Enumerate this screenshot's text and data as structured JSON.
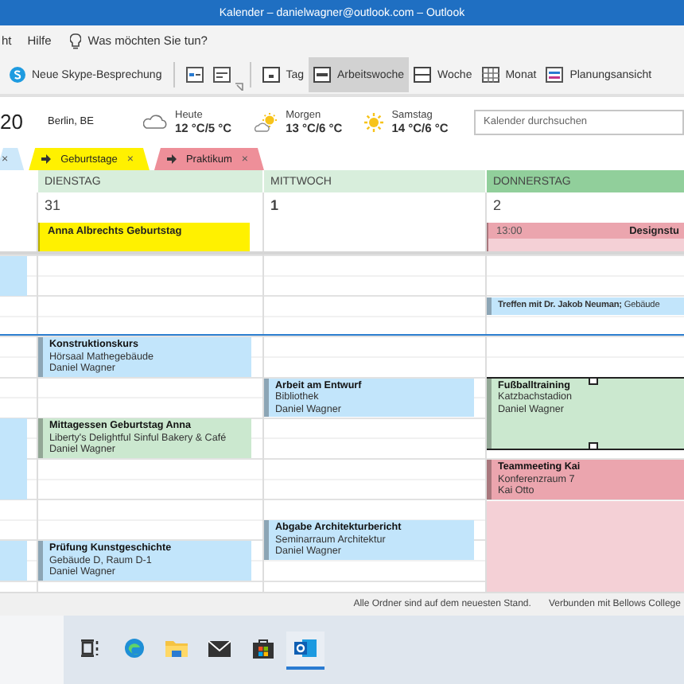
{
  "window": {
    "title": "Kalender – danielwagner@outlook.com – Outlook"
  },
  "menu": {
    "items": [
      "ht",
      "Hilfe"
    ],
    "tell_me": "Was möchten Sie tun?"
  },
  "ribbon": {
    "skype": "Neue Skype-Besprechung",
    "views": [
      {
        "label": "Tag",
        "kind": "day",
        "selected": false
      },
      {
        "label": "Arbeitswoche",
        "kind": "workweek",
        "selected": true
      },
      {
        "label": "Woche",
        "kind": "week",
        "selected": false
      },
      {
        "label": "Monat",
        "kind": "month",
        "selected": false
      },
      {
        "label": "Planungsansicht",
        "kind": "schedule",
        "selected": false
      }
    ]
  },
  "weather": {
    "date": "20",
    "location": "Berlin, BE",
    "forecast": [
      {
        "day": "Heute",
        "temp": "12 °C/5 °C",
        "kind": "cloudy"
      },
      {
        "day": "Morgen",
        "temp": "13 °C/6 °C",
        "kind": "partly-sunny"
      },
      {
        "day": "Samstag",
        "temp": "14 °C/6 °C",
        "kind": "sunny"
      }
    ],
    "search": {
      "placeholder": "Kalender durchsuchen"
    }
  },
  "calendar_tabs": [
    {
      "close": "×",
      "color": "#cde8fa"
    },
    {
      "label": "Geburtstage",
      "close": "×",
      "color": "#fff100"
    },
    {
      "label": "Praktikum",
      "close": "×",
      "color": "#ee8f99"
    }
  ],
  "columns": [
    {
      "events": [
        {
          "kind": "block",
          "color": "#c2e5fb"
        },
        {
          "kind": "block",
          "color": "#c2e5fb"
        },
        {
          "kind": "block",
          "color": "#c2e5fb"
        }
      ]
    },
    {
      "day": "DIENSTAG",
      "date": "31",
      "today": false,
      "current": false,
      "all_day": [
        {
          "title": "Anna Albrechts Geburtstag",
          "color": "#fff100"
        }
      ],
      "events": [
        {
          "kind": "appointment",
          "title": "Konstruktionskurs",
          "location": "Hörsaal Mathegebäude",
          "organizer": "Daniel Wagner",
          "color": "#c2e5fb",
          "selected": false
        },
        {
          "kind": "appointment",
          "title": "Mittagessen Geburtstag Anna",
          "location": "Liberty's Delightful Sinful Bakery & Café",
          "organizer": "Daniel Wagner",
          "color": "#cbe8cf",
          "selected": false
        },
        {
          "kind": "appointment",
          "title": "Prüfung Kunstgeschichte",
          "location": "Gebäude D, Raum D-1",
          "organizer": "Daniel Wagner",
          "color": "#c2e5fb",
          "selected": false
        }
      ]
    },
    {
      "day": "MITTWOCH",
      "date": "1",
      "today": false,
      "current": true,
      "events": [
        {
          "kind": "appointment",
          "title": "Arbeit am Entwurf",
          "location": "Bibliothek",
          "organizer": "Daniel Wagner",
          "color": "#c2e5fb",
          "selected": false
        },
        {
          "kind": "appointment",
          "title": "Abgabe Architekturbericht",
          "location": "Seminarraum Architektur",
          "organizer": "Daniel Wagner",
          "color": "#c2e5fb",
          "selected": false
        }
      ]
    },
    {
      "day": "DONNERSTAG",
      "date": "2",
      "today": true,
      "current": false,
      "all_day": [
        {
          "time": "13:00",
          "title": "Designstu",
          "color": "#eba5ae"
        }
      ],
      "events": [
        {
          "kind": "block",
          "color": "#f4d0d6"
        },
        {
          "kind": "appointment",
          "title": "Treffen mit Dr. Jakob Neuman;",
          "location": "Gebäude",
          "color": "#c2e5fb",
          "selected": false
        },
        {
          "kind": "appointment",
          "title": "Fußballtraining",
          "location": "Katzbachstadion",
          "organizer": "Daniel Wagner",
          "color": "#cbe8cf",
          "selected": true
        },
        {
          "kind": "appointment",
          "title": "Teammeeting Kai",
          "location": "Konferenzraum 7",
          "organizer": "Kai Otto",
          "color": "#eba5ae",
          "selected": false
        }
      ]
    }
  ],
  "status_bar": [
    "Alle Ordner sind auf dem neuesten Stand.",
    "Verbunden mit Bellows College"
  ],
  "taskbar": [
    {
      "kind": "taskview",
      "active": false
    },
    {
      "kind": "browser",
      "active": false
    },
    {
      "kind": "folder",
      "active": false
    },
    {
      "kind": "mail",
      "active": false
    },
    {
      "kind": "store",
      "active": false
    },
    {
      "kind": "outlook",
      "active": true
    }
  ]
}
